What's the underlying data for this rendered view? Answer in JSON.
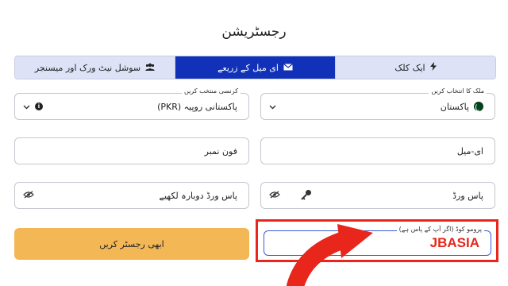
{
  "page": {
    "title": "رجسٹریشن"
  },
  "tabs": [
    {
      "label": "سوشل نیٹ ورک اور میسنجر",
      "icon": "users-icon",
      "active": false
    },
    {
      "label": "ای میل کے زریعے",
      "icon": "envelope-icon",
      "active": true
    },
    {
      "label": "ایک کلک",
      "icon": "lightning-icon",
      "active": false
    }
  ],
  "form": {
    "currency": {
      "legend": "کرنسی منتخب کریں",
      "value": "پاکستانی روپیہ (PKR)"
    },
    "country": {
      "legend": "ملک کا انتخاب کریں",
      "value": "پاکستان"
    },
    "phone": {
      "placeholder": "فون نمبر"
    },
    "email": {
      "placeholder": "ای-میل"
    },
    "password_repeat": {
      "placeholder": "پاس ورڈ دوبارہ لکھیے"
    },
    "password": {
      "placeholder": "پاس ورڈ"
    },
    "promo": {
      "legend": "پرومو کوڈ (اگر آپ کے پاس ہے)",
      "value": "JBASIA"
    },
    "submit_label": "ابھی رجسٹر کریں"
  },
  "colors": {
    "accent": "#1131b8",
    "tab_bg": "#dde2f7",
    "button": "#f3b756",
    "highlight": "#e8261b"
  }
}
